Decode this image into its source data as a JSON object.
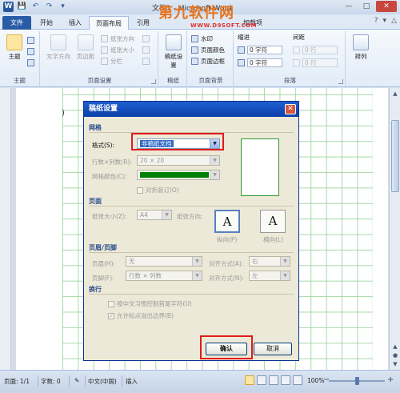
{
  "window": {
    "title": "文档1 - Microsoft Word",
    "controls": [
      "—",
      "□",
      "✕"
    ]
  },
  "quick_access": [
    "W",
    "💾",
    "↶",
    "↷",
    "▾"
  ],
  "watermark": {
    "text": "第九软件网",
    "url": "WWW.D9SOFT.COM"
  },
  "tabs": [
    {
      "label": "文件"
    },
    {
      "label": "开始"
    },
    {
      "label": "插入"
    },
    {
      "label": "页面布局"
    },
    {
      "label": "引用"
    },
    {
      "label": "加载项"
    }
  ],
  "ribbon_controls": [
    "?",
    "▾",
    "△"
  ],
  "ribbon": {
    "theme_group": {
      "label": "主题",
      "theme_button": "主题"
    },
    "page_setup_group": {
      "label": "页面设置",
      "text_direction": "文字方向",
      "margins": "页边距",
      "paper_orientation": "纸张方向",
      "paper_size": "纸张大小",
      "columns": "分栏"
    },
    "manuscript_group": {
      "label": "稿纸",
      "manuscript_settings": "稿纸设置"
    },
    "page_background_group": {
      "label": "页面背景",
      "watermark": "水印",
      "page_color": "页面颜色",
      "page_border": "页面边框"
    },
    "paragraph_group": {
      "label": "段落",
      "indent_title": "缩进",
      "spacing_title": "间距",
      "indent_left": "0 字符",
      "indent_right": "0 字符",
      "spacing_before": "0 行",
      "spacing_after": "0 行"
    },
    "arrange_group": {
      "arrange": "排列"
    }
  },
  "dialog": {
    "title": "稿纸设置",
    "close": "✕",
    "grid_section": "网格",
    "format_label": "格式(S):",
    "format_value": "非稿纸文档",
    "rows_cols_label": "行数×列数(R):",
    "rows_cols_value": "20 × 20",
    "grid_color_label": "网格颜色(C):",
    "grid_color": "#008000",
    "fold_print_label": "对折装订(O)",
    "page_section": "页面",
    "paper_size_label": "纸张大小(Z):",
    "paper_size_value": "A4",
    "orientation_label": "纸张方向:",
    "portrait": "纵向(P)",
    "landscape": "横向(L)",
    "portrait_glyph": "A",
    "landscape_glyph": "A",
    "header_footer_section": "页眉/页脚",
    "header_label": "页眉(H):",
    "header_value": "无",
    "footer_label": "页脚(F):",
    "footer_value": "行数 × 列数",
    "align_label_1": "对齐方式(A):",
    "align_value_1": "右",
    "align_label_2": "对齐方式(N):",
    "align_value_2": "左",
    "wrap_section": "换行",
    "wrap_option_1": "按中文习惯控制首尾字符(U)",
    "wrap_option_2": "允许标点溢出边界(B)",
    "ok": "确认",
    "cancel": "取消"
  },
  "status_bar": {
    "page": "页面: 1/1",
    "words": "字数: 0",
    "language": "中文(中国)",
    "mode": "插入",
    "zoom": "100%",
    "zoom_minus": "−",
    "zoom_plus": "+"
  },
  "colors": {
    "accent": "#2b579a",
    "highlight_box": "#e21a1a",
    "grid_line": "#a8d8a8",
    "dialog_title": "#0b3fa8"
  }
}
